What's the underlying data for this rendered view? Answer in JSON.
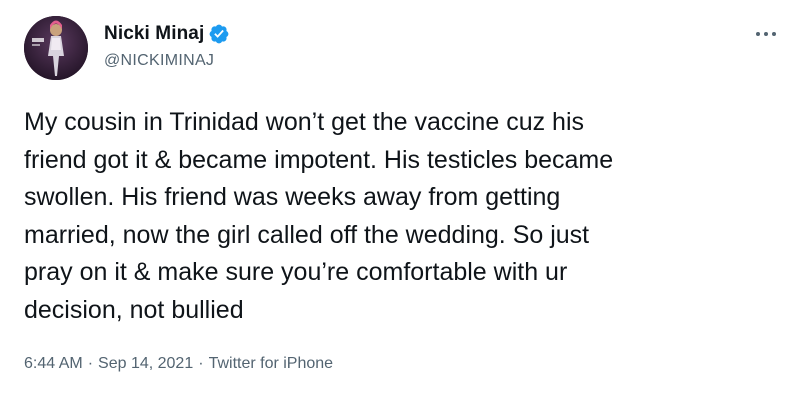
{
  "author": {
    "display_name": "Nicki Minaj",
    "handle": "@NICKIMINAJ"
  },
  "tweet": {
    "text": "My cousin in Trinidad won’t get the vaccine cuz his\nfriend got it & became impotent. His testicles became\nswollen. His friend was weeks away from getting\nmarried, now the girl called off the wedding. So just\npray on it & make sure you’re comfortable with ur\ndecision, not bullied"
  },
  "meta": {
    "time": "6:44 AM",
    "separator": "·",
    "date": "Sep 14, 2021",
    "source": "Twitter for iPhone"
  },
  "icons": {
    "verified": "verified-badge-icon",
    "more": "more-options-icon"
  },
  "colors": {
    "verified_blue": "#1d9bf0",
    "text_primary": "#0f1419",
    "text_secondary": "#536471"
  }
}
